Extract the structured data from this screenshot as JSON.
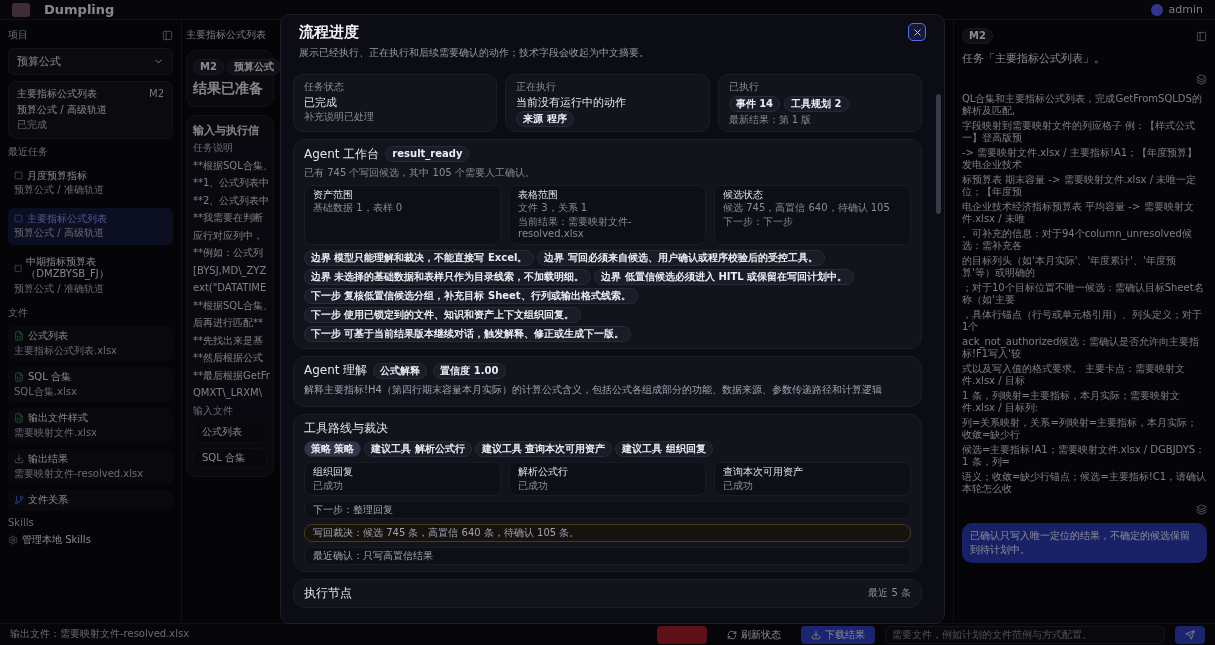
{
  "topbar": {
    "brand": "Dumpling",
    "user": "admin"
  },
  "sidebar": {
    "project_label": "项目",
    "project": "预算公式",
    "current_task": {
      "title": "主要指标公式列表",
      "badge": "M2",
      "subtitle": "预算公式 / 高级轨道",
      "status": "已完成"
    },
    "recent_label": "最近任务",
    "tasks": [
      {
        "title": "月度预算指标",
        "subtitle": "预算公式 / 准确轨道",
        "selected": false
      },
      {
        "title": "主要指标公式列表",
        "subtitle": "预算公式 / 高级轨道",
        "selected": true
      },
      {
        "title": "中期指标预算表（DMZBYSB_FJ）",
        "subtitle": "预算公式 / 准确轨道",
        "selected": false
      }
    ],
    "files_label": "文件",
    "files": [
      {
        "kind": "sheet",
        "name": "公式列表",
        "file": "主要指标公式列表.xlsx"
      },
      {
        "kind": "sheet",
        "name": "SQL 合集",
        "file": "SQL合集.xlsx"
      },
      {
        "kind": "sheet",
        "name": "输出文件样式",
        "file": "需要映射文件.xlsx"
      },
      {
        "kind": "output",
        "name": "输出结果",
        "file": "需要映射文件-resolved.xlsx"
      },
      {
        "kind": "relation",
        "name": "文件关系"
      }
    ],
    "skills_label": "Skills",
    "skills_item": "管理本地 Skills"
  },
  "middle": {
    "tab": "主要指标公式列表",
    "result_card": {
      "chips": [
        "M2",
        "预算公式"
      ],
      "title": "结果已准备"
    },
    "info_card": {
      "title": "输入与执行信",
      "label": "任务说明",
      "lines": [
        "**根据SQL合集、",
        "**1、公式列表中",
        "**2、公式列表中",
        "**我需要在判断",
        "应行对应列中，",
        "**例如：公式列",
        "[BYSJ,MD\\_ZYZ",
        "ext(\"DATATIME",
        "**根据SQL合集、",
        "后再进行匹配**",
        "**先找出来是基",
        "**然后根据公式",
        "**最后根据GetFr",
        "QMXT\\_LRXM\\"
      ],
      "inputs_label": "输入文件",
      "inputs": [
        "公式列表",
        "SQL 合集"
      ]
    }
  },
  "chat": {
    "badge": "M2",
    "intro": "任务「主要指标公式列表」。",
    "paragraph_lines": [
      "QL合集和主要指标公式列表，完成GetFromSQLDS的解析及匹配,",
      "字段映射到需要映射文件的列应格子 例：【样式公式一】登高版预",
      "-> 需要映射文件.xlsx / 主要指标!A1；【年度预算】发电企业技术",
      "标预算表 期末容量 -> 需要映射文件.xlsx / 未唯一定位；【年度预",
      "电企业技术经济指标预算表 平均容量 -> 需要映射文件.xlsx / 未唯",
      "。可补充的信息：对于94个column_unresolved候选：需补充各",
      "的目标列头（如'本月实际'、'年度累计'、'年度预算'等）或明确的",
      "；对于10个目标位置不唯一候选：需确认目标Sheet名称（如'主要",
      "，具体行锚点（行号或单元格引用）、列头定义；对于1个",
      "ack_not_authorized候选：需确认是否允许向主要指标!F1写入'较",
      "式以及写入值的格式要求。 主要卡点：需要映射文件.xlsx / 目标",
      "1 条，列映射=主要指标，本月实际；需要映射文件.xlsx / 目标列:",
      "列=关系映射，关系=列映射=主要指标，本月实际；收敛=缺少行",
      "候选=主要指标!A1；需要映射文件.xlsx / DGBJDYS：1 条，列=",
      "语义；收敛=缺少行锚点；候选=主要指标!C1，请确认本轮怎么收"
    ],
    "bubble": "已确认只写入唯一定位的结果，不确定的候选保留到待计划中。"
  },
  "bottom": {
    "output_file": "输出文件：需要映射文件-resolved.xlsx",
    "refresh": "刷新状态",
    "download": "下载结果",
    "input_placeholder": "需要文件，例如计划的文件范例与方式配置。"
  },
  "modal": {
    "title": "流程进度",
    "subtitle": "展示已经执行、正在执行和后续需要确认的动作；技术字段会收起为中文摘要。",
    "stats": [
      {
        "label": "任务状态",
        "value": "已完成",
        "note": "补充说明已处理"
      },
      {
        "label": "正在执行",
        "value": "当前没有运行中的动作",
        "chips": [
          "来源 程序"
        ]
      },
      {
        "label": "已执行",
        "chips": [
          "事件 14",
          "工具规划 2"
        ],
        "note": "最新结果：第 1 版"
      }
    ],
    "workbench": {
      "title": "Agent 工作台",
      "badge": "result_ready",
      "summary": "已有 745 个写回候选，其中 105 个需要人工确认。",
      "cards": [
        {
          "title": "资产范围",
          "lines": [
            "基础数据 1，表样 0"
          ]
        },
        {
          "title": "表格范围",
          "lines": [
            "文件 3，关系 1",
            "当前结果：需要映射文件-resolved.xlsx"
          ]
        },
        {
          "title": "候选状态",
          "lines": [
            "候选 745，高置信 640，待确认 105",
            "下一步：下一步"
          ]
        }
      ],
      "chips": [
        {
          "tag": "边界",
          "text": "模型只能理解和裁决，不能直接写 Excel。"
        },
        {
          "tag": "边界",
          "text": "写回必须来自候选、用户确认或程序校验后的受控工具。"
        },
        {
          "tag": "边界",
          "text": "未选择的基础数据和表样只作为目录线索，不加载明细。"
        },
        {
          "tag": "边界",
          "text": "低置信候选必须进入 HITL 或保留在写回计划中。"
        },
        {
          "tag": "下一步",
          "text": "复核低置信候选分组，补充目标 Sheet、行列或输出格式线索。"
        },
        {
          "tag": "下一步",
          "text": "使用已锁定到的文件、知识和资产上下文组织回复。"
        },
        {
          "tag": "下一步",
          "text": "可基于当前结果版本继续对话，触发解释、修正或生成下一版。"
        }
      ]
    },
    "understanding": {
      "title": "Agent 理解",
      "chips": [
        "公式解释",
        "置信度 1.00"
      ],
      "text": "解释主要指标!H4（第四行期末容量本月实际）的计算公式含义，包括公式各组成部分的功能、数据来源、参数传递路径和计算逻辑"
    },
    "tools": {
      "title": "工具路线与裁决",
      "chips": [
        {
          "text": "策略 策略",
          "selected": true
        },
        {
          "text": "建议工具 解析公式行",
          "selected": false
        },
        {
          "text": "建议工具 查询本次可用资产",
          "selected": false
        },
        {
          "text": "建议工具 组织回复",
          "selected": false
        }
      ],
      "cards": [
        {
          "title": "组织回复",
          "status": "已成功"
        },
        {
          "title": "解析公式行",
          "status": "已成功"
        },
        {
          "title": "查询本次可用资产",
          "status": "已成功"
        }
      ],
      "rows": [
        {
          "kind": "plain",
          "text": "下一步：整理回复"
        },
        {
          "kind": "warning",
          "text": "写回裁决：候选 745 条，高置信 640 条，待确认 105 条。"
        },
        {
          "kind": "plain",
          "text": "最近确认：只写高置信结果"
        }
      ]
    },
    "nodes": {
      "title": "执行节点",
      "count": "最近 5 条"
    }
  }
}
